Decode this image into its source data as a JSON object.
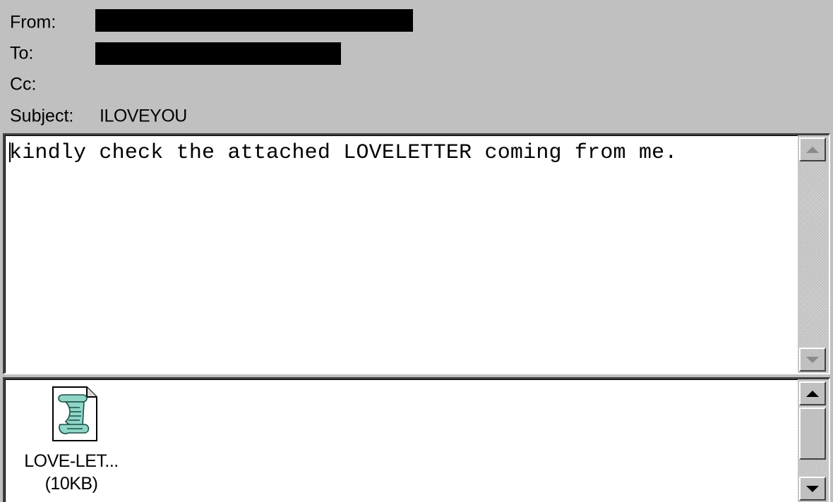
{
  "header": {
    "from_label": "From:",
    "from_value": "",
    "to_label": "To:",
    "to_value": "",
    "cc_label": "Cc:",
    "cc_value": "",
    "subject_label": "Subject:",
    "subject_value": "ILOVEYOU"
  },
  "message": {
    "body": "kindly check the attached LOVELETTER coming from me."
  },
  "attachments": [
    {
      "name": "LOVE-LET...",
      "size": "(10KB)",
      "icon": "script-scroll-icon"
    }
  ],
  "colors": {
    "window_background": "#c0c0c0",
    "pane_background": "#ffffff",
    "redaction": "#000000",
    "icon_scroll": "#8fd6c6"
  }
}
